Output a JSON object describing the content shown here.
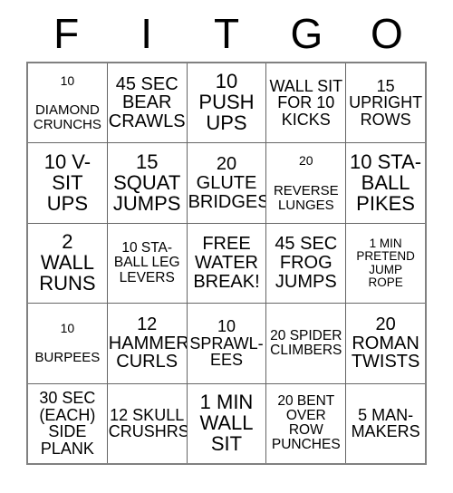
{
  "card": {
    "title_letters": [
      "F",
      "I",
      "T",
      "G",
      "O"
    ],
    "colors": {
      "background": "#ffffff",
      "text": "#000000",
      "grid_line": "#666666",
      "outer_border": "#808080"
    },
    "rows": [
      [
        {
          "lead": "10",
          "rest": "DIAMOND\nCRUNCHS",
          "full": "10 DIAMOND CRUNCHS"
        },
        {
          "lead": "",
          "rest": "45 SEC\nBEAR\nCRAWLS",
          "full": "45 SEC BEAR CRAWLS"
        },
        {
          "lead": "",
          "rest": "10\nPUSH\nUPS",
          "full": "10 PUSH UPS"
        },
        {
          "lead": "",
          "rest": "WALL SIT\nFOR 10\nKICKS",
          "full": "WALL SIT FOR 10 KICKS"
        },
        {
          "lead": "",
          "rest": "15\nUPRIGHT\nROWS",
          "full": "15 UPRIGHT ROWS"
        }
      ],
      [
        {
          "lead": "",
          "rest": "10 V-\nSIT\nUPS",
          "full": "10 V-SIT UPS"
        },
        {
          "lead": "",
          "rest": "15\nSQUAT\nJUMPS",
          "full": "15 SQUAT JUMPS"
        },
        {
          "lead": "",
          "rest": "20\nGLUTE\nBRIDGES",
          "full": "20 GLUTE BRIDGES"
        },
        {
          "lead": "20",
          "rest": "REVERSE\nLUNGES",
          "full": "20 REVERSE LUNGES"
        },
        {
          "lead": "",
          "rest": "10 STA-\nBALL\nPIKES",
          "full": "10 STA-BALL PIKES"
        }
      ],
      [
        {
          "lead": "",
          "rest": "2\nWALL\nRUNS",
          "full": "2 WALL RUNS"
        },
        {
          "lead": "",
          "rest": "10 STA-\nBALL LEG\nLEVERS",
          "full": "10 STA-BALL LEG LEVERS"
        },
        {
          "lead": "",
          "rest": "FREE\nWATER\nBREAK!",
          "full": "FREE WATER BREAK!"
        },
        {
          "lead": "",
          "rest": "45 SEC\nFROG\nJUMPS",
          "full": "45 SEC FROG JUMPS"
        },
        {
          "lead": "",
          "rest": "1 MIN\nPRETEND\nJUMP\nROPE",
          "full": "1 MIN PRETEND JUMP ROPE"
        }
      ],
      [
        {
          "lead": "10",
          "rest": "BURPEES",
          "full": "10 BURPEES"
        },
        {
          "lead": "",
          "rest": "12\nHAMMER\nCURLS",
          "full": "12 HAMMER CURLS"
        },
        {
          "lead": "",
          "rest": "10\nSPRAWL-\nEES",
          "full": "10 SPRAWL-EES"
        },
        {
          "lead": "",
          "rest": "20 SPIDER\nCLIMBERS",
          "full": "20 SPIDER CLIMBERS"
        },
        {
          "lead": "",
          "rest": "20\nROMAN\nTWISTS",
          "full": "20 ROMAN TWISTS"
        }
      ],
      [
        {
          "lead": "",
          "rest": "30 SEC\n(EACH)\nSIDE\nPLANK",
          "full": "30 SEC (EACH) SIDE PLANK"
        },
        {
          "lead": "",
          "rest": "12 SKULL\nCRUSHRS",
          "full": "12 SKULL CRUSHRS"
        },
        {
          "lead": "",
          "rest": "1 MIN\nWALL\nSIT",
          "full": "1 MIN WALL SIT"
        },
        {
          "lead": "",
          "rest": "20 BENT\nOVER\nROW\nPUNCHES",
          "full": "20 BENT OVER ROW PUNCHES"
        },
        {
          "lead": "",
          "rest": "5 MAN-\nMAKERS",
          "full": "5 MAN-MAKERS"
        }
      ]
    ]
  }
}
